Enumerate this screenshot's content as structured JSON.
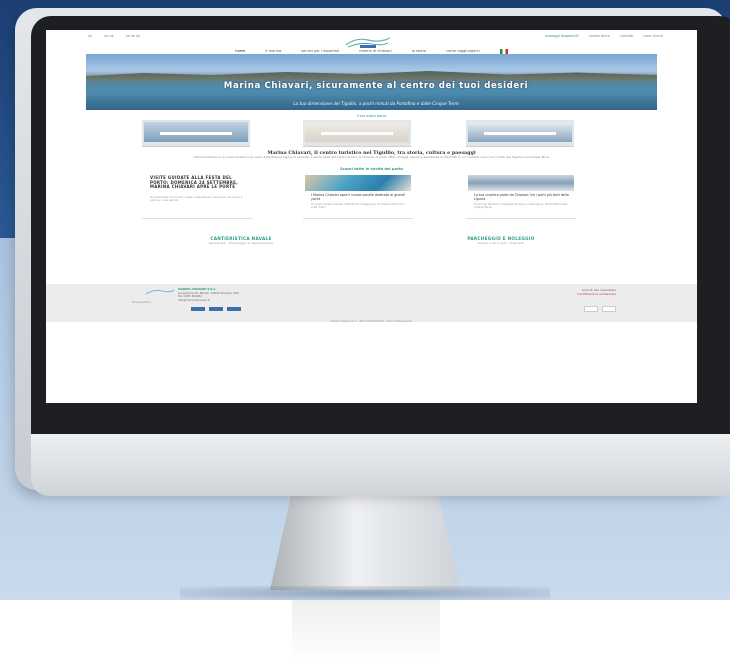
{
  "site": {
    "topbar_left": [
      "ok",
      "ok ok",
      "ok ok ok"
    ],
    "topbar_right": [
      "ormeggi disponibili",
      "cantieristica",
      "contatti",
      "area clienti"
    ],
    "nav": [
      "home",
      "il marina",
      "servizi per i diportisti",
      "marina di chiavari",
      "la storia",
      "come raggiungerci"
    ],
    "hero_title": "Marina Chiavari, sicuramente al centro dei tuoi desideri",
    "hero_subtitle": "La tua dimensione del Tigullio, a pochi minuti da Portofino e dalle Cinque Terre",
    "link_strip": "il tuo posto barca",
    "section_title": "Marina Chiavari, il centro turistico nel Tigullio, tra storia, cultura e paesaggi",
    "section_text": "Marina Chiavari è un porto turistico nel cuore della Riviera Ligure di Levante, a pochi passi dal centro storico di Chiavari. Il porto offre ormeggi, servizi e assistenza ai diportisti in un contesto unico tra il Golfo del Tigullio e le Cinque Terre.",
    "link_line": "Scopri tutte le novità del porto",
    "news": [
      {
        "title": "VISITE GUIDATE ALLA FESTA DEL PORTO: DOMENICA 24 SETTEMBRE, MARINA CHIAVARI APRE LE PORTE",
        "text": "Una giornata di incontri, visite e attività per conoscere da vicino il porto e i suoi servizi."
      },
      {
        "caption": "I Marina Chiavari apre il nuovo pontile dedicato ai grandi yacht",
        "sub": "Il nuovo pontile amplia l'offerta di ormeggi per le imbarcazioni fino a 40 metri."
      },
      {
        "caption": "La tua crociera parte da Chiavari: tra i porti più belli della Liguria",
        "sub": "Scopri gli itinerari consigliati lungo la costa ligure, da Portofino alle Cinque Terre."
      }
    ],
    "cta_left": "CANTIERISTICA NAVALE",
    "cta_left_sub": "assistenza, rimessaggio e manutenzione",
    "cta_right": "PARCHEGGIO E NOLEGGIO",
    "cta_right_sub": "servizi a terra per i diportisti",
    "footer": {
      "company": "MARINA CHIAVARI S.R.L.",
      "address": "Lungomare Ido Bartoli, 16043 Chiavari (GE)",
      "phone": "Tel. 0185 364061",
      "email": "info@marinachiavari.it",
      "left_note": "Privacy Policy",
      "right_title": "Iscriviti alla newsletter",
      "right_note": "Certificazione ambientale",
      "copyright": "Marina Chiavari S.r.l. - P.IVA 00000000000 - Tutti i diritti riservati"
    }
  },
  "colors": {
    "accent": "#2e9b8a",
    "background_top": "#1c3f73",
    "background_mid": "#a9c3df"
  }
}
